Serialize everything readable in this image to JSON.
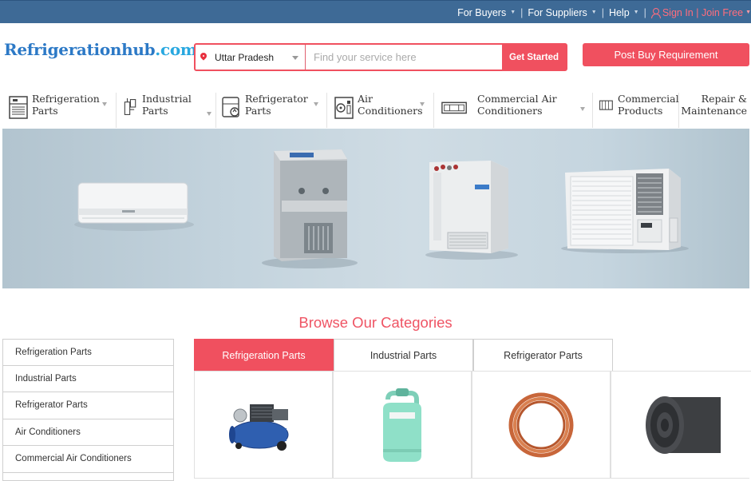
{
  "topnav": {
    "for_buyers": "For Buyers",
    "for_suppliers": "For Suppliers",
    "help": "Help",
    "sign_in": "Sign In | Join Free"
  },
  "logo": {
    "name": "Refrigerationhub",
    "domain": ".com"
  },
  "search": {
    "location": "Uttar Pradesh",
    "placeholder": "Find your service here",
    "button": "Get Started"
  },
  "post_buy": "Post Buy Requirement",
  "categories": [
    {
      "line1": "Refrigeration",
      "line2": "Parts",
      "icon": "refrigeration-parts-icon"
    },
    {
      "line1": "Industrial Parts",
      "line2": "",
      "icon": "industrial-parts-icon"
    },
    {
      "line1": "Refrigerator",
      "line2": "Parts",
      "icon": "refrigerator-parts-icon"
    },
    {
      "line1": "Air",
      "line2": "Conditioners",
      "icon": "air-conditioner-icon"
    },
    {
      "line1": "Commercial Air",
      "line2": "Conditioners",
      "icon": "commercial-ac-icon"
    },
    {
      "line1": "Commercial",
      "line2": "Products",
      "icon": "commercial-products-icon"
    },
    {
      "line1": "Repair &",
      "line2": "Maintenance",
      "icon": ""
    }
  ],
  "browse_title": "Browse Our Categories",
  "side_list": [
    "Refrigeration Parts",
    "Industrial Parts",
    "Refrigerator Parts",
    "Air Conditioners",
    "Commercial Air Conditioners"
  ],
  "tabs": [
    "Refrigeration Parts",
    "Industrial Parts",
    "Refrigerator Parts"
  ],
  "products": [
    "air-compressor",
    "refrigerant-gas-cylinder",
    "copper-pipe-coil",
    "insulation-foam-roll"
  ],
  "colors": {
    "topbar": "#3e6a96",
    "accent": "#f0505f",
    "logo_blue": "#2c79c6"
  }
}
